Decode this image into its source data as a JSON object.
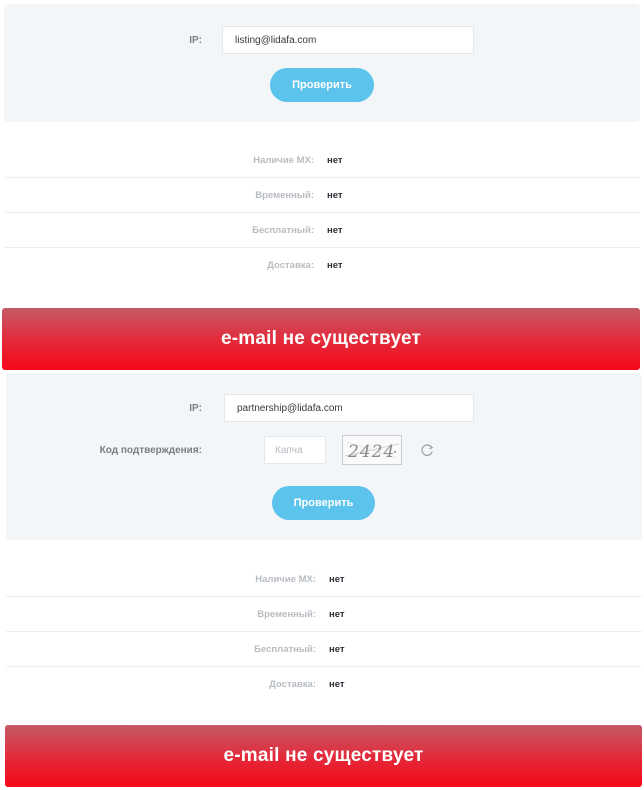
{
  "section1": {
    "ip_label": "IP:",
    "email_value": "listing@lidafa.com",
    "check_button": "Проверить",
    "results": [
      {
        "label": "Наличие MX:",
        "value": "нет"
      },
      {
        "label": "Временный:",
        "value": "нет"
      },
      {
        "label": "Бесплатный:",
        "value": "нет"
      },
      {
        "label": "Доставка:",
        "value": "нет"
      }
    ],
    "banner": "e-mail не существует"
  },
  "section2": {
    "ip_label": "IP:",
    "email_value": "partnership@lidafa.com",
    "captcha_label": "Код подтверждения:",
    "captcha_placeholder": "Капча",
    "captcha_text": "2424",
    "check_button": "Проверить",
    "results": [
      {
        "label": "Наличие MX:",
        "value": "нет"
      },
      {
        "label": "Временный:",
        "value": "нет"
      },
      {
        "label": "Бесплатный:",
        "value": "нет"
      },
      {
        "label": "Доставка:",
        "value": "нет"
      }
    ],
    "banner": "e-mail не существует"
  },
  "colors": {
    "accent_button": "#5bc3ec",
    "error_banner": "#f5071a",
    "panel_background": "#f3f6f8"
  },
  "icons": {
    "refresh": "refresh-icon"
  }
}
